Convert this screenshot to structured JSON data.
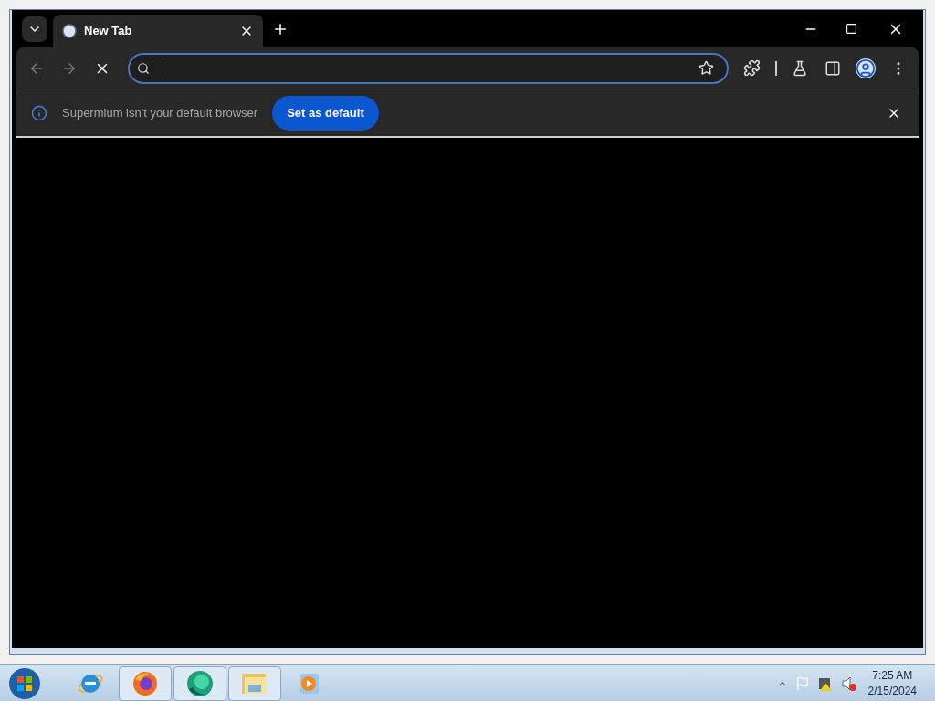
{
  "browser": {
    "tabs": [
      {
        "title": "New Tab",
        "selected": true
      }
    ],
    "infobar": {
      "message": "Supermium isn't your default browser",
      "button": "Set as default"
    }
  },
  "taskbar": {
    "apps": [
      {
        "kind": "ie",
        "running": false
      },
      {
        "kind": "firefox",
        "running": true
      },
      {
        "kind": "globe",
        "running": true
      },
      {
        "kind": "folder",
        "running": true
      },
      {
        "kind": "media",
        "running": false
      }
    ],
    "time": "7:25 AM",
    "date": "2/15/2024"
  }
}
